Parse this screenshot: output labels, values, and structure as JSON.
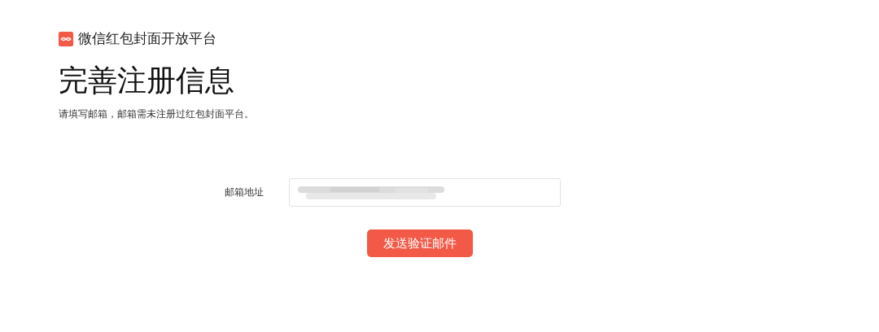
{
  "brand": {
    "name": "微信红包封面开放平台"
  },
  "page": {
    "title": "完善注册信息",
    "subtitle": "请填写邮箱，邮箱需未注册过红包封面平台。"
  },
  "form": {
    "fields": [
      {
        "label": "邮箱地址"
      }
    ],
    "submit": "发送验证邮件"
  }
}
